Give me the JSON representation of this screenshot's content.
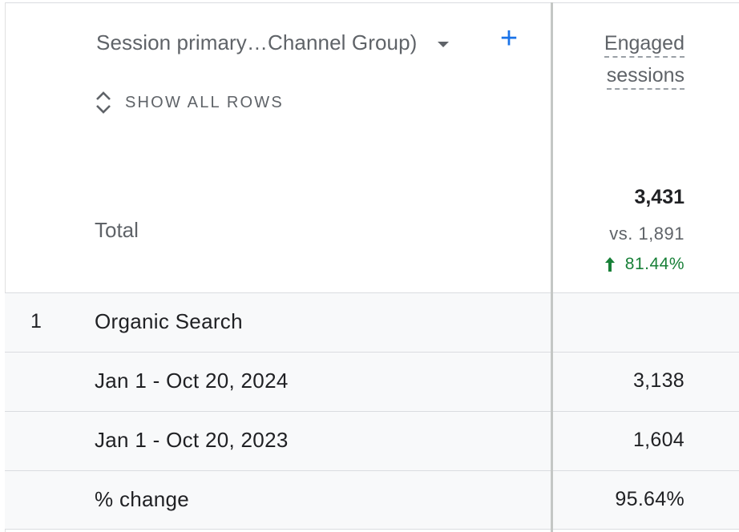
{
  "dimension": {
    "label": "Session primary…Channel Group)",
    "add_icon": "plus-icon",
    "dropdown_icon": "caret-down-icon"
  },
  "show_all_rows": {
    "label": "SHOW ALL ROWS",
    "icon": "unfold-icon"
  },
  "metric": {
    "line1": "Engaged",
    "line2": "sessions"
  },
  "total": {
    "label": "Total",
    "value": "3,431",
    "comparison": "vs. 1,891",
    "change": "81.44%",
    "change_color": "#188038"
  },
  "rows": [
    {
      "index": "1",
      "label": "Organic Search",
      "value": ""
    },
    {
      "index": "",
      "label": "Jan 1 - Oct 20, 2024",
      "value": "3,138"
    },
    {
      "index": "",
      "label": "Jan 1 - Oct 20, 2023",
      "value": "1,604"
    },
    {
      "index": "",
      "label": "% change",
      "value": "95.64%"
    }
  ],
  "colors": {
    "accent": "#1a73e8",
    "positive": "#188038",
    "row_bg": "#f8f9fa"
  }
}
